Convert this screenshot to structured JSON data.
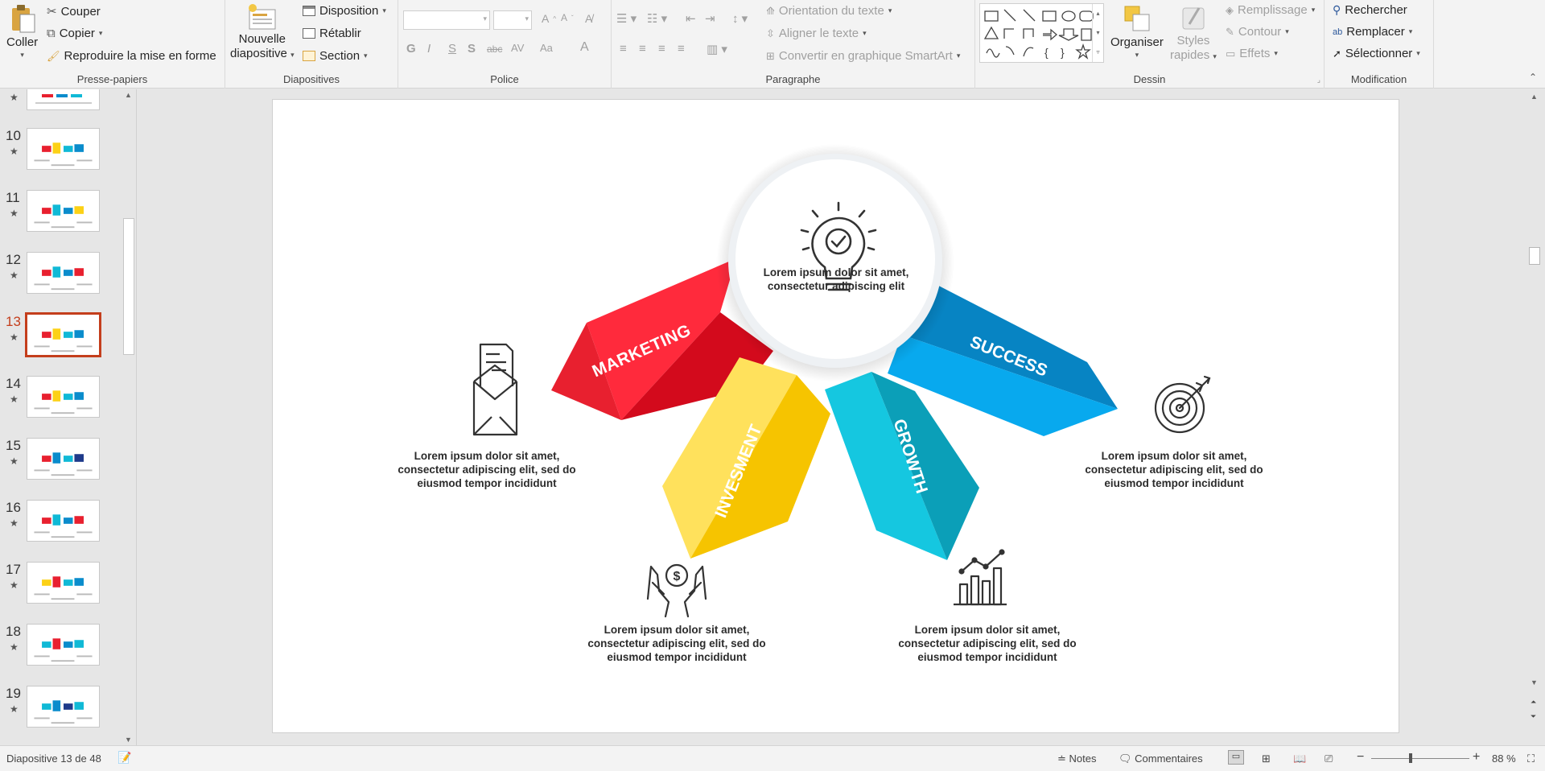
{
  "ribbon": {
    "clipboard": {
      "paste": "Coller",
      "cut": "Couper",
      "copy": "Copier",
      "format_painter": "Reproduire la mise en forme",
      "label": "Presse-papiers"
    },
    "slides": {
      "new_slide_1": "Nouvelle",
      "new_slide_2": "diapositive",
      "layout": "Disposition",
      "reset": "Rétablir",
      "section": "Section",
      "label": "Diapositives"
    },
    "font": {
      "bold": "G",
      "italic": "I",
      "underline": "S",
      "shadow": "S",
      "strike": "abc",
      "spacing": "AV",
      "case": "Aa",
      "color": "A",
      "label": "Police"
    },
    "paragraph": {
      "text_direction": "Orientation du texte",
      "align_text": "Aligner le texte",
      "smartart": "Convertir en graphique SmartArt",
      "label": "Paragraphe"
    },
    "drawing": {
      "arrange": "Organiser",
      "quick_styles_1": "Styles",
      "quick_styles_2": "rapides",
      "fill": "Remplissage",
      "outline": "Contour",
      "effects": "Effets",
      "label": "Dessin"
    },
    "editing": {
      "find": "Rechercher",
      "replace": "Remplacer",
      "select": "Sélectionner",
      "label": "Modification"
    }
  },
  "thumbnails": [
    {
      "num": "10"
    },
    {
      "num": "11"
    },
    {
      "num": "12"
    },
    {
      "num": "13",
      "selected": true
    },
    {
      "num": "14"
    },
    {
      "num": "15"
    },
    {
      "num": "16"
    },
    {
      "num": "17"
    },
    {
      "num": "18"
    },
    {
      "num": "19"
    }
  ],
  "slide": {
    "center_text_1": "Lorem ipsum dolor sit amet,",
    "center_text_2": "consectetur adipiscing elit",
    "arms": {
      "marketing": "MARKETING",
      "invesment": "INVESMENT",
      "growth": "GROWTH",
      "success": "SUCCESS"
    },
    "blocks": {
      "left": [
        "Lorem ipsum dolor sit amet,",
        "consectetur adipiscing elit, sed do",
        "eiusmod tempor incididunt"
      ],
      "right": [
        "Lorem ipsum dolor sit amet,",
        "consectetur adipiscing elit, sed do",
        "eiusmod tempor incididunt"
      ],
      "bottom_left": [
        "Lorem ipsum dolor sit amet,",
        "consectetur adipiscing elit, sed do",
        "eiusmod tempor incididunt"
      ],
      "bottom_right": [
        "Lorem ipsum dolor sit amet,",
        "consectetur adipiscing elit, sed do",
        "eiusmod tempor incididunt"
      ]
    },
    "colors": {
      "red": "#e8202f",
      "yellow": "#fcd116",
      "cyan": "#10b9d6",
      "blue": "#0a8ccc"
    }
  },
  "status": {
    "slide_info": "Diapositive 13 de 48",
    "notes": "Notes",
    "comments": "Commentaires",
    "zoom": "88 %"
  }
}
